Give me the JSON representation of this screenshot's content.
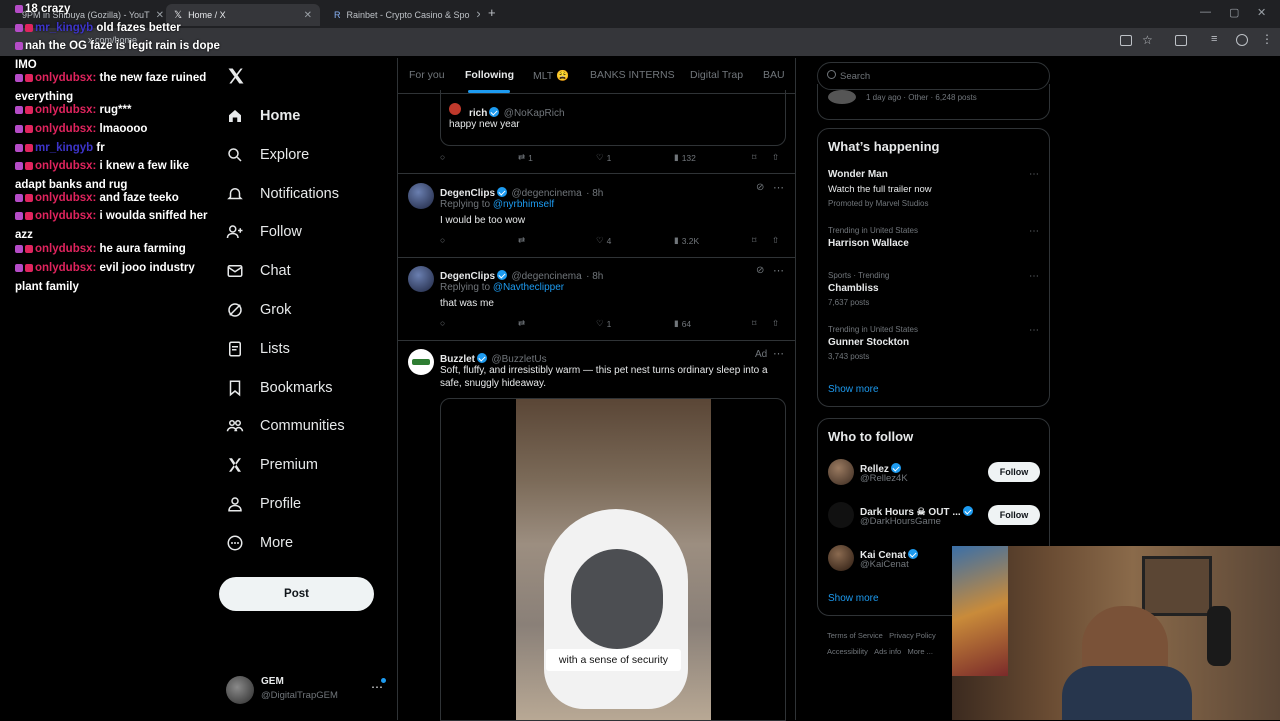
{
  "browser": {
    "tabs": [
      {
        "label": "9PM in Shibuya (Gozilla) - YouT",
        "active": false
      },
      {
        "label": "Home / X",
        "active": true
      },
      {
        "label": "Rainbet - Crypto Casino & Spo",
        "active": false
      }
    ],
    "url": "x.com/home"
  },
  "chat": [
    {
      "user": "",
      "message": "18 crazy"
    },
    {
      "user": "mr_kingyb",
      "message": "old fazes better"
    },
    {
      "user": "",
      "message": "nah the OG faze is legit rain is dope IMO"
    },
    {
      "user": "onlydubsx:",
      "message": "the new faze ruined everything"
    },
    {
      "user": "onlydubsx:",
      "message": "rug***"
    },
    {
      "user": "onlydubsx:",
      "message": "lmaoooo"
    },
    {
      "user": "mr_kingyb",
      "message": "fr"
    },
    {
      "user": "onlydubsx:",
      "message": "i knew a few like adapt banks and rug"
    },
    {
      "user": "onlydubsx:",
      "message": "and faze teeko"
    },
    {
      "user": "onlydubsx:",
      "message": "i woulda sniffed her azz"
    },
    {
      "user": "onlydubsx:",
      "message": "he aura farming"
    },
    {
      "user": "onlydubsx:",
      "message": "evil jooo industry plant family"
    }
  ],
  "nav": {
    "items": [
      "Home",
      "Explore",
      "Notifications",
      "Follow",
      "Chat",
      "Grok",
      "Lists",
      "Bookmarks",
      "Communities",
      "Premium",
      "Profile",
      "More"
    ],
    "post_button": "Post",
    "account": {
      "name": "GEM",
      "handle": "@DigitalTrapGEM"
    }
  },
  "timeline": {
    "tabs": [
      "For you",
      "Following",
      "MLT 😩",
      "BANKS INTERNS",
      "Digital Trap",
      "BAU"
    ],
    "active_tab": "Following",
    "quoted": {
      "name": "rich",
      "handle": "@NoKapRich",
      "text": "happy new year"
    },
    "first_actions": {
      "replies": "",
      "reposts": "1",
      "likes": "1",
      "views": "132"
    },
    "posts": [
      {
        "name": "DegenClips",
        "handle": "@degencinema",
        "time": "· 8h",
        "replying_prefix": "Replying to",
        "replying_to": "@nyrbhimself",
        "text": "I would be too wow",
        "replies": "",
        "reposts": "",
        "likes": "4",
        "views": "3.2K"
      },
      {
        "name": "DegenClips",
        "handle": "@degencinema",
        "time": "· 8h",
        "replying_prefix": "Replying to",
        "replying_to": "@Navtheclipper",
        "text": "that was me",
        "replies": "",
        "reposts": "",
        "likes": "1",
        "views": "64"
      }
    ],
    "ad": {
      "name": "Buzzlet",
      "handle": "@BuzzletUs",
      "label": "Ad",
      "text": "Soft, fluffy, and irresistibly warm — this pet nest turns ordinary sleep into a safe, snuggly hideaway.",
      "caption": "with a sense of security"
    }
  },
  "sidebar": {
    "search_placeholder": "Search",
    "top_meta": "1 day ago · Other · 6,248 posts",
    "happening": {
      "title": "What’s happening",
      "items": [
        {
          "meta": "",
          "title": "Wonder Man",
          "sub": "Watch the full trailer now",
          "promo": "Promoted by Marvel Studios"
        },
        {
          "meta": "Trending in United States",
          "title": "Harrison Wallace",
          "sub": ""
        },
        {
          "meta": "Sports · Trending",
          "title": "Chambliss",
          "sub": "7,637 posts"
        },
        {
          "meta": "Trending in United States",
          "title": "Gunner Stockton",
          "sub": "3,743 posts"
        }
      ],
      "show_more": "Show more"
    },
    "who_to_follow": {
      "title": "Who to follow",
      "users": [
        {
          "name": "Rellez",
          "handle": "@Rellez4K",
          "button": "Follow"
        },
        {
          "name": "Dark Hours ☠ OUT ...",
          "handle": "@DarkHoursGame",
          "button": "Follow"
        },
        {
          "name": "Kai Cenat",
          "handle": "@KaiCenat",
          "button": ""
        }
      ],
      "show_more": "Show more"
    },
    "footer": [
      "Terms of Service",
      "Privacy Policy",
      "Accessibility",
      "Ads info",
      "More ..."
    ]
  },
  "colors": {
    "accent": "#1d9bf0",
    "chat_user": "#e0245e",
    "background": "#000000"
  }
}
